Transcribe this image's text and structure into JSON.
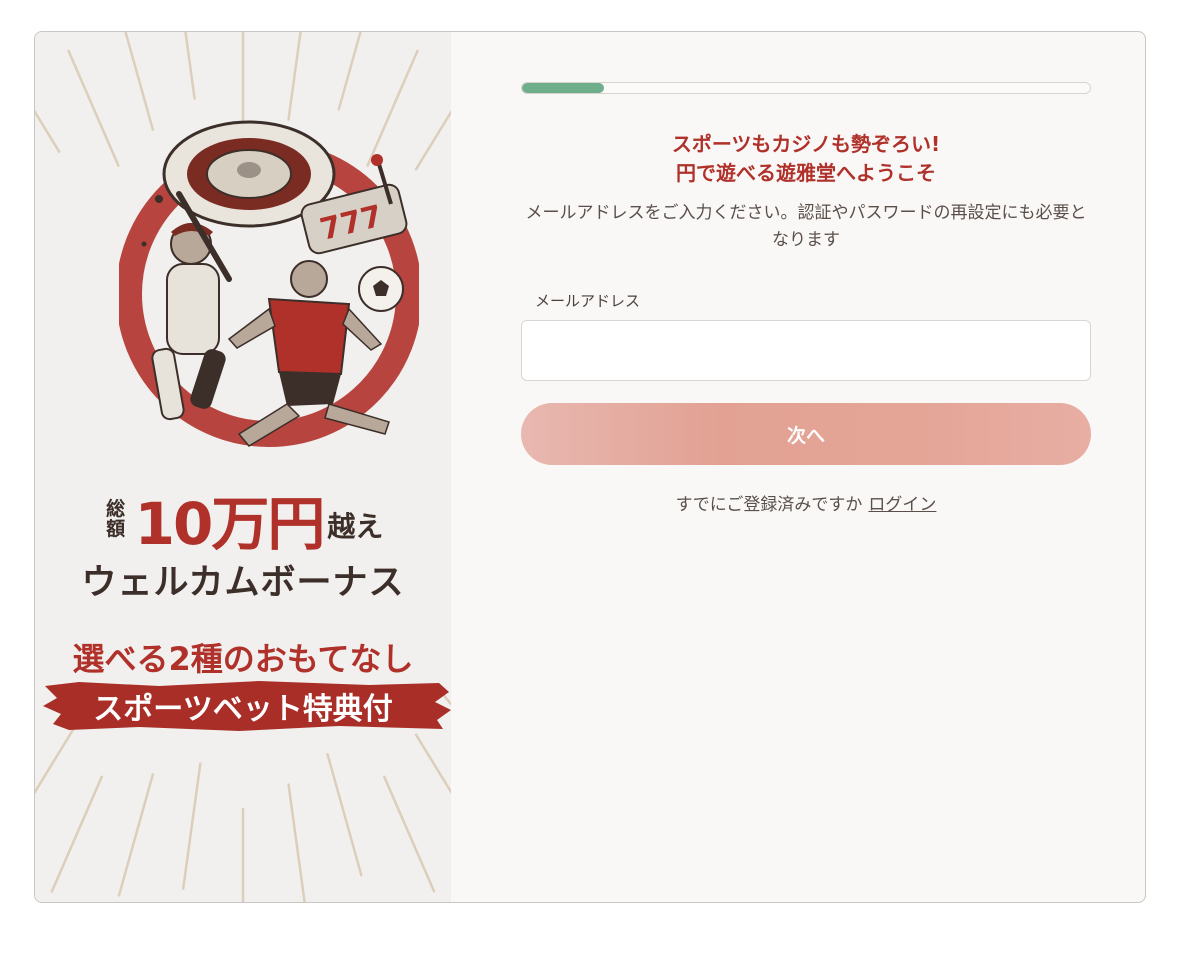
{
  "banner": {
    "headline_small": "総額",
    "headline_big": "10万円",
    "headline_suffix": "越え",
    "headline_line2": "ウェルカムボーナス",
    "headline_line3": "選べる2種のおもてなし",
    "headline_line4": "スポーツベット特典付",
    "accent_color": "#b0312a",
    "illustration_icon": "sports-casino-illustration"
  },
  "form": {
    "progress_fraction": 0.145,
    "progress_color": "#6fae8a",
    "title_line1": "スポーツもカジノも勢ぞろい!",
    "title_line2": "円で遊べる遊雅堂へようこそ",
    "description": "メールアドレスをご入力ください。認証やパスワードの再設定にも必要となります",
    "email_label": "メールアドレス",
    "email_value": "",
    "email_placeholder": "",
    "next_label": "次へ",
    "already_registered": "すでにご登録済みですか",
    "login_label": "ログイン"
  }
}
